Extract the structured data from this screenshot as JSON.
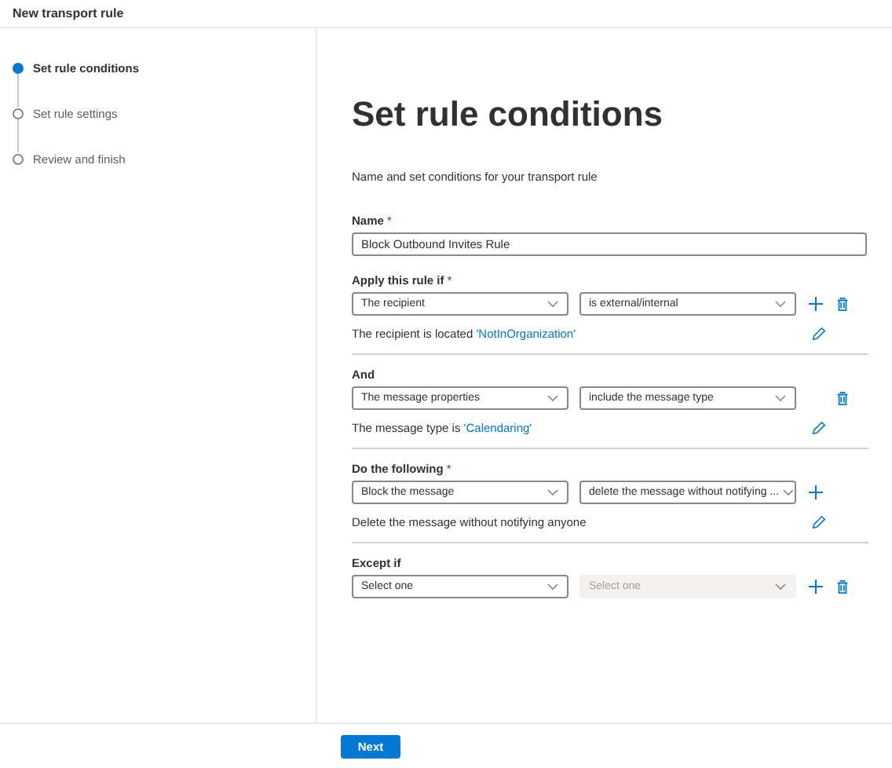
{
  "window": {
    "title": "New transport rule"
  },
  "steps": [
    {
      "label": "Set rule conditions",
      "selected": true
    },
    {
      "label": "Set rule settings",
      "selected": false
    },
    {
      "label": "Review and finish",
      "selected": false
    }
  ],
  "heading": "Set rule conditions",
  "subtitle": "Name and set conditions for your transport rule",
  "name_field": {
    "label": "Name",
    "required_mark": "*",
    "value": "Block Outbound Invites Rule"
  },
  "sections": [
    {
      "label": "Apply this rule if",
      "required_mark": "*",
      "select_1": {
        "value": "The recipient",
        "disabled": false
      },
      "select_2": {
        "value": "is external/internal",
        "disabled": false
      },
      "actions": [
        {
          "kind": "add"
        },
        {
          "kind": "delete"
        }
      ],
      "description": "The recipient is located ",
      "link": "'NotInOrganization'"
    },
    {
      "label": "And",
      "select_1": {
        "value": "The message properties",
        "disabled": false
      },
      "select_2": {
        "value": "include the message type",
        "disabled": false
      },
      "actions": [
        {
          "kind": "spacer"
        },
        {
          "kind": "delete"
        }
      ],
      "description": "The message type is ",
      "link": "'Calendaring'"
    },
    {
      "label": "Do the following",
      "required_mark": "*",
      "select_1": {
        "value": "Block the message",
        "disabled": false
      },
      "select_2": {
        "value": "delete the message without notifying ...",
        "disabled": false
      },
      "actions": [
        {
          "kind": "add"
        }
      ],
      "description": "Delete the message without notifying anyone"
    },
    {
      "label": "Except if",
      "select_1": {
        "value": "Select one",
        "disabled": false
      },
      "select_2": {
        "value": "Select one",
        "disabled": true
      },
      "actions": [
        {
          "kind": "add"
        },
        {
          "kind": "delete"
        }
      ]
    }
  ],
  "footer": {
    "next_button": "Next"
  }
}
